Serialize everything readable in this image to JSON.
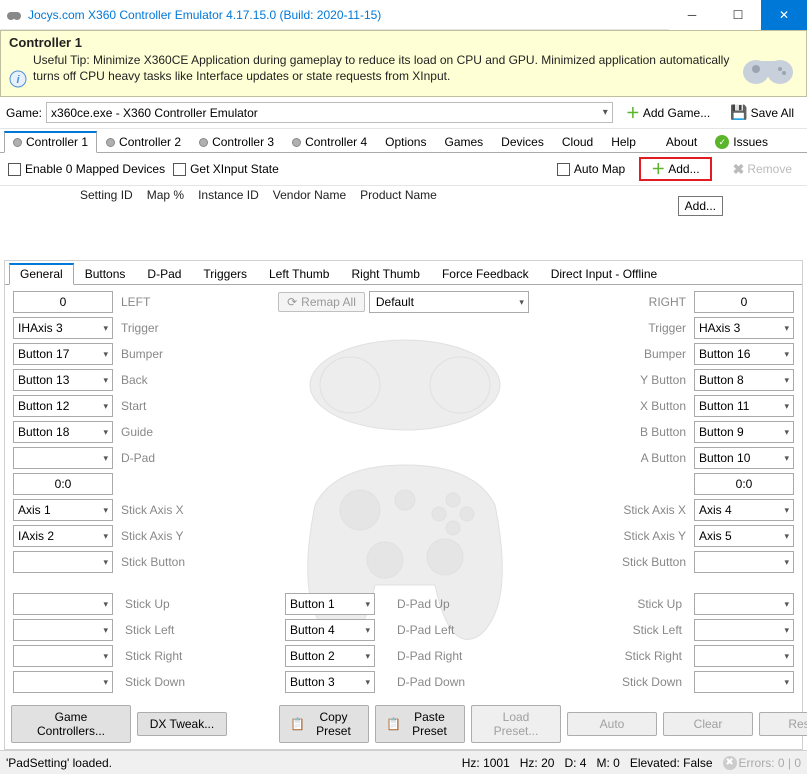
{
  "window": {
    "title": "Jocys.com X360 Controller Emulator 4.17.15.0 (Build: 2020-11-15)"
  },
  "banner": {
    "title": "Controller 1",
    "text": "Useful Tip: Minimize X360CE Application during gameplay to reduce its load on CPU and GPU. Minimized application automatically turns off CPU heavy tasks like Interface updates or state requests from XInput."
  },
  "game_row": {
    "label": "Game:",
    "selected": "x360ce.exe - X360 Controller Emulator",
    "add_game": "Add Game...",
    "save_all": "Save All"
  },
  "main_tabs": {
    "controller1": "Controller 1",
    "controller2": "Controller 2",
    "controller3": "Controller 3",
    "controller4": "Controller 4",
    "options": "Options",
    "games": "Games",
    "devices": "Devices",
    "cloud": "Cloud",
    "help": "Help",
    "about": "About",
    "issues": "Issues"
  },
  "ctl_bar": {
    "enable_mapped": "Enable 0 Mapped Devices",
    "get_xinput": "Get XInput State",
    "auto_map": "Auto Map",
    "add": "Add...",
    "remove": "Remove"
  },
  "tooltip": "Add...",
  "table_headers": {
    "setting_id": "Setting ID",
    "map_pct": "Map %",
    "instance_id": "Instance ID",
    "vendor_name": "Vendor Name",
    "product_name": "Product Name"
  },
  "sub_tabs": {
    "general": "General",
    "buttons": "Buttons",
    "dpad": "D-Pad",
    "triggers": "Triggers",
    "left_thumb": "Left Thumb",
    "right_thumb": "Right Thumb",
    "force_feedback": "Force Feedback",
    "direct_input": "Direct Input - Offline"
  },
  "mapping": {
    "col_left": "LEFT",
    "col_right": "RIGHT",
    "remap_all": "Remap All",
    "preset": "Default",
    "left_num": "0",
    "right_num": "0",
    "left_00": "0:0",
    "right_00": "0:0",
    "rows": {
      "trigger": "Trigger",
      "bumper": "Bumper",
      "back": "Back",
      "start": "Start",
      "guide": "Guide",
      "dpad": "D-Pad",
      "y_button": "Y Button",
      "x_button": "X Button",
      "b_button": "B Button",
      "a_button": "A Button",
      "stick_axis_x": "Stick Axis X",
      "stick_axis_y": "Stick Axis Y",
      "stick_button": "Stick Button",
      "stick_up": "Stick Up",
      "stick_left": "Stick Left",
      "stick_right": "Stick Right",
      "stick_down": "Stick Down",
      "dpad_up": "D-Pad Up",
      "dpad_left": "D-Pad Left",
      "dpad_right": "D-Pad Right",
      "dpad_down": "D-Pad Down"
    },
    "left_vals": {
      "trigger": "IHAxis 3",
      "bumper": "Button 17",
      "back": "Button 13",
      "start": "Button 12",
      "guide": "Button 18",
      "dpad": "",
      "axis_x": "Axis 1",
      "axis_y": "IAxis 2",
      "stick_btn": ""
    },
    "right_vals": {
      "trigger": "HAxis 3",
      "bumper": "Button 16",
      "y": "Button 8",
      "x": "Button 11",
      "b": "Button 9",
      "a": "Button 10",
      "axis_x": "Axis 4",
      "axis_y": "Axis 5",
      "stick_btn": ""
    },
    "dpad_vals": {
      "up": "Button 1",
      "left": "Button 4",
      "right": "Button 2",
      "down": "Button 3"
    }
  },
  "bottom": {
    "game_controllers": "Game Controllers...",
    "dx_tweak": "DX Tweak...",
    "copy_preset": "Copy Preset",
    "paste_preset": "Paste Preset",
    "load_preset": "Load Preset...",
    "auto": "Auto",
    "clear": "Clear",
    "reset": "Reset"
  },
  "status": {
    "left": "'PadSetting' loaded.",
    "hz": "Hz: 1001",
    "hz2": "Hz: 20",
    "d": "D: 4",
    "m": "M: 0",
    "elevated": "Elevated: False",
    "errors": "Errors: 0 | 0"
  }
}
